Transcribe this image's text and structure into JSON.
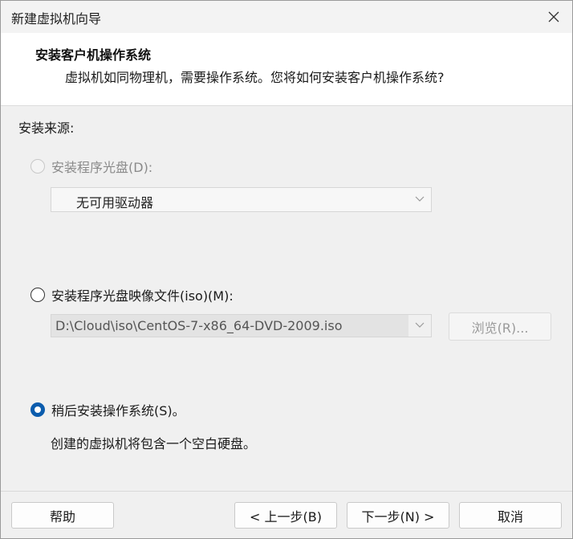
{
  "window": {
    "title": "新建虚拟机向导"
  },
  "header": {
    "title": "安装客户机操作系统",
    "subtitle": "虚拟机如同物理机，需要操作系统。您将如何安装客户机操作系统?"
  },
  "source": {
    "label": "安装来源:",
    "disc_option": {
      "label": "安装程序光盘(D):",
      "enabled": false,
      "selected": false,
      "drive_selected": "无可用驱动器"
    },
    "iso_option": {
      "label": "安装程序光盘映像文件(iso)(M):",
      "enabled": true,
      "selected": false,
      "path_value": "D:\\Cloud\\iso\\CentOS-7-x86_64-DVD-2009.iso",
      "browse_label": "浏览(R)..."
    },
    "later_option": {
      "label": "稍后安装操作系统(S)。",
      "enabled": true,
      "selected": true,
      "note": "创建的虚拟机将包含一个空白硬盘。"
    }
  },
  "footer": {
    "help_label": "帮助",
    "back_label": "< 上一步(B)",
    "next_label": "下一步(N) >",
    "cancel_label": "取消"
  },
  "colors": {
    "accent": "#0b5cad",
    "window_bg": "#f0f0f0",
    "header_bg": "#ffffff",
    "disabled_text": "#8a8a8a"
  },
  "icons": {
    "close": "close-icon",
    "dropdown": "chevron-down-icon"
  }
}
